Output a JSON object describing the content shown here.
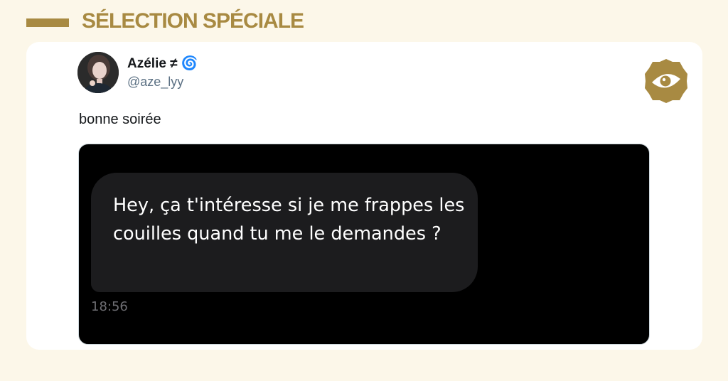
{
  "header": {
    "title": "SÉLECTION SPÉCIALE"
  },
  "tweet": {
    "author": {
      "display_name": "Azélie ≠ ",
      "name_emoji": "🌀",
      "handle": "@aze_lyy",
      "avatar_icon": "profile-photo"
    },
    "text": "bonne soirée",
    "media": {
      "message_text": "Hey, ça t'intéresse si je me frappes les couilles quand tu me le demandes ?",
      "message_time": "18:56"
    }
  },
  "brand": {
    "logo_icon": "brand-eye-badge-icon",
    "accent": "#a88a42"
  }
}
